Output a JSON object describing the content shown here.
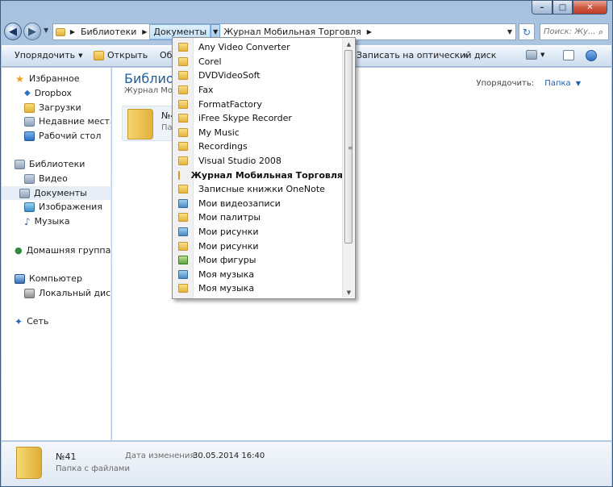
{
  "window": {
    "minimize_label": "–",
    "maximize_label": "□",
    "close_label": "✕"
  },
  "nav": {
    "back_glyph": "◀",
    "forward_glyph": "▶",
    "refresh_glyph": "↻"
  },
  "address": {
    "crumbs": [
      "Библиотеки",
      "Документы",
      "Журнал Мобильная Торговля"
    ],
    "separator": "▶",
    "open_separator": "▼",
    "dropdown_glyph": "▼"
  },
  "search": {
    "placeholder": "Поиск: Жу...",
    "icon_glyph": "⌕"
  },
  "toolbar": {
    "organize": "Упорядочить",
    "open": "Открыть",
    "share_partial": "Об",
    "burn": "Записать на оптический диск",
    "more": "»",
    "caret": "▼"
  },
  "sidebar": {
    "favorites": "Избранное",
    "dropbox": "Dropbox",
    "downloads": "Загрузки",
    "recent": "Недавние места",
    "desktop": "Рабочий стол",
    "libraries": "Библиотеки",
    "video": "Видео",
    "documents": "Документы",
    "images": "Изображения",
    "music": "Музыка",
    "homegroup": "Домашняя группа",
    "computer": "Компьютер",
    "local_disk": "Локальный диск (C",
    "network": "Сеть"
  },
  "main": {
    "title_partial": "Библиот",
    "subtitle_partial": "Журнал Моб",
    "arrange_label": "Упорядочить:",
    "arrange_value": "Папка",
    "arrange_caret": "▼",
    "tile_name": "№4",
    "tile_type_partial": "Па"
  },
  "dropdown": {
    "items": [
      {
        "label": "Any Video Converter",
        "bold": false,
        "icon": "folder"
      },
      {
        "label": "Corel",
        "bold": false,
        "icon": "folder"
      },
      {
        "label": "DVDVideoSoft",
        "bold": false,
        "icon": "folder"
      },
      {
        "label": "Fax",
        "bold": false,
        "icon": "folder"
      },
      {
        "label": "FormatFactory",
        "bold": false,
        "icon": "folder"
      },
      {
        "label": "iFree Skype Recorder",
        "bold": false,
        "icon": "folder"
      },
      {
        "label": "My Music",
        "bold": false,
        "icon": "folder"
      },
      {
        "label": "Recordings",
        "bold": false,
        "icon": "folder"
      },
      {
        "label": "Visual Studio 2008",
        "bold": false,
        "icon": "folder"
      },
      {
        "label": "Журнал Мобильная Торговля",
        "bold": true,
        "icon": "folder"
      },
      {
        "label": "Записные книжки OneNote",
        "bold": false,
        "icon": "folder"
      },
      {
        "label": "Мои видеозаписи",
        "bold": false,
        "icon": "folder-video"
      },
      {
        "label": "Мои палитры",
        "bold": false,
        "icon": "folder"
      },
      {
        "label": "Мои рисунки",
        "bold": false,
        "icon": "folder-pictures"
      },
      {
        "label": "Мои рисунки",
        "bold": false,
        "icon": "folder"
      },
      {
        "label": "Мои фигуры",
        "bold": false,
        "icon": "folder-shapes"
      },
      {
        "label": "Моя музыка",
        "bold": false,
        "icon": "folder-music"
      },
      {
        "label": "Моя музыка",
        "bold": false,
        "icon": "folder"
      }
    ],
    "scroll_up": "▲",
    "scroll_down": "▼",
    "grip": "≡"
  },
  "details": {
    "name": "№41",
    "type": "Папка с файлами",
    "date_label": "Дата изменения:",
    "date_value": "30.05.2014 16:40"
  }
}
